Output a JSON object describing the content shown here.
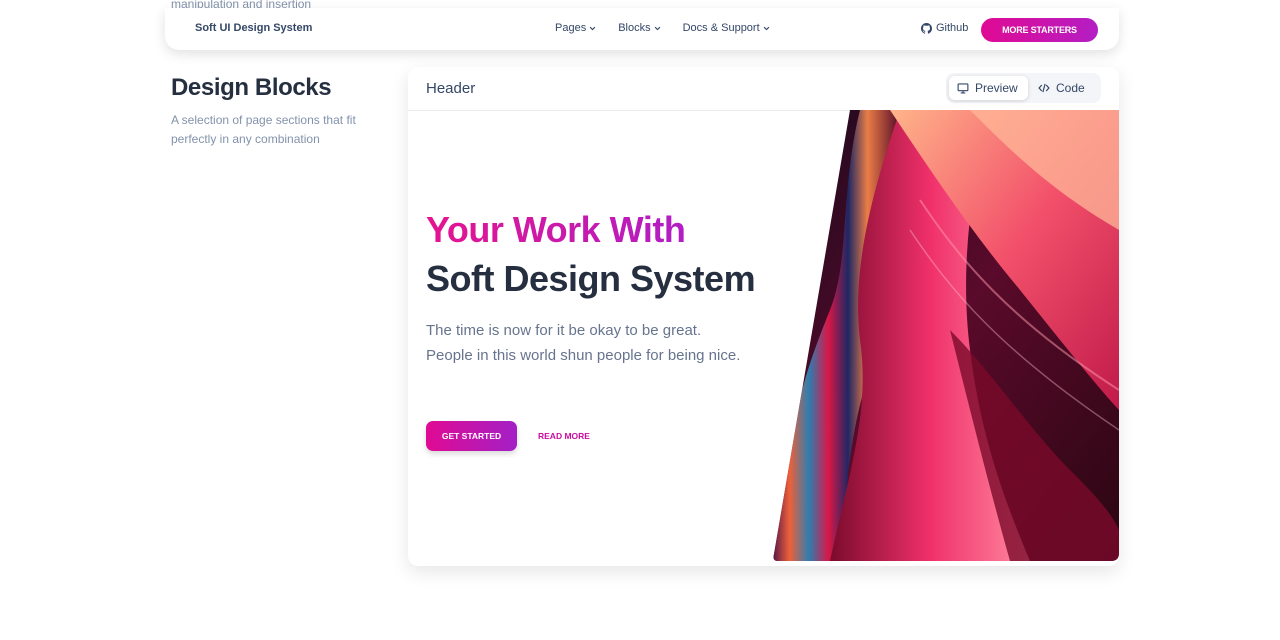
{
  "top_cut_text": "manipulation and insertion",
  "navbar": {
    "brand": "Soft UI Design System",
    "menu": [
      {
        "label": "Pages"
      },
      {
        "label": "Blocks"
      },
      {
        "label": "Docs & Support"
      }
    ],
    "github_label": "Github",
    "cta_label": "MORE STARTERS"
  },
  "intro": {
    "title": "Design Blocks",
    "description": "A selection of page sections that fit perfectly in any combination"
  },
  "card": {
    "title": "Header",
    "toggle": {
      "preview_label": "Preview",
      "code_label": "Code",
      "active": "Preview"
    },
    "hero": {
      "line1": "Your Work With",
      "line2": "Soft Design System",
      "paragraph": "The time is now for it be okay to be great. People in this world shun people for being nice.",
      "primary_button": "GET STARTED",
      "secondary_link": "READ MORE"
    }
  },
  "colors": {
    "brand_gradient_start": "#e00a93",
    "brand_gradient_end": "#a320c6",
    "heading": "#252f40",
    "text_muted": "#67748e"
  }
}
